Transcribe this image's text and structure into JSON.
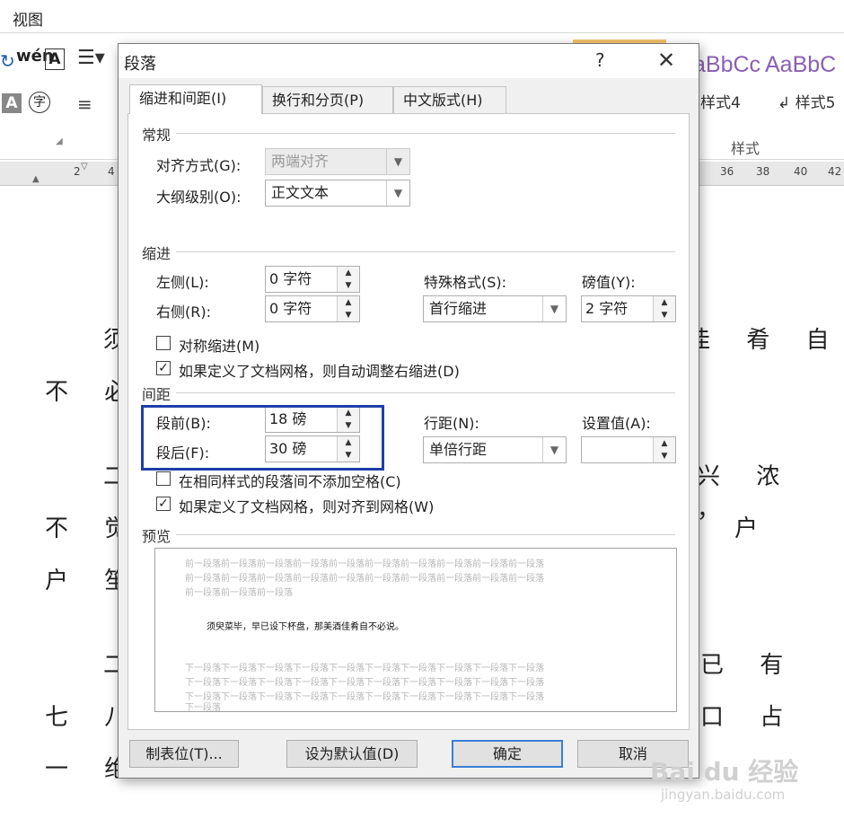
{
  "menu": {
    "view": "视图"
  },
  "ribbon": {
    "style_samples": [
      "aBbCc",
      "AaBbC"
    ],
    "style_labels": [
      "样式4",
      "↲ 样式5"
    ],
    "group_label": "样式"
  },
  "ruler": {
    "left_ticks": [
      "2",
      "4"
    ],
    "right_ticks": [
      "36",
      "38",
      "40",
      "42"
    ]
  },
  "document": {
    "fragments": [
      "须",
      "不 必",
      "二",
      "不 觉",
      "户 笙",
      "二",
      "七 八",
      "一 绝",
      "佳 肴 自",
      "兴 浓 ，",
      "户",
      "已 有",
      "口 占"
    ]
  },
  "dialog": {
    "title": "段落",
    "help": "?",
    "close": "✕",
    "tabs": [
      {
        "label": "缩进和间距(I)",
        "active": true
      },
      {
        "label": "换行和分页(P)",
        "active": false
      },
      {
        "label": "中文版式(H)",
        "active": false
      }
    ],
    "general": {
      "title": "常规",
      "alignment_label": "对齐方式(G):",
      "alignment_value": "两端对齐",
      "outline_label": "大纲级别(O):",
      "outline_value": "正文文本"
    },
    "indent": {
      "title": "缩进",
      "left_label": "左侧(L):",
      "left_value": "0 字符",
      "right_label": "右侧(R):",
      "right_value": "0 字符",
      "special_label": "特殊格式(S):",
      "special_value": "首行缩进",
      "by_label": "磅值(Y):",
      "by_value": "2 字符",
      "mirror_label": "对称缩进(M)",
      "mirror_checked": false,
      "auto_right_label": "如果定义了文档网格，则自动调整右缩进(D)",
      "auto_right_checked": true
    },
    "spacing": {
      "title": "间距",
      "before_label": "段前(B):",
      "before_value": "18 磅",
      "after_label": "段后(F):",
      "after_value": "30 磅",
      "line_label": "行距(N):",
      "line_value": "单倍行距",
      "at_label": "设置值(A):",
      "at_value": "",
      "no_space_label": "在相同样式的段落间不添加空格(C)",
      "no_space_checked": false,
      "snap_label": "如果定义了文档网格，则对齐到网格(W)",
      "snap_checked": true
    },
    "preview": {
      "title": "预览",
      "prev_lines": [
        "前一段落前一段落前一段落前一段落前一段落前一段落前一段落前一段落前一段落前一段落",
        "前一段落前一段落前一段落前一段落前一段落前一段落前一段落前一段落前一段落前一段落",
        "前一段落前一段落前一段落"
      ],
      "sample_text": "须臾菜毕，早已设下杯盘，那美酒佳肴自不必说。",
      "next_lines": [
        "下一段落下一段落下一段落下一段落下一段落下一段落下一段落下一段落下一段落下一段落",
        "下一段落下一段落下一段落下一段落下一段落下一段落下一段落下一段落下一段落下一段落",
        "下一段落下一段落下一段落下一段落下一段落下一段落下一段落下一段落下一段落下一段落",
        "下一段落"
      ]
    },
    "buttons": {
      "tabs": "制表位(T)...",
      "set_default": "设为默认值(D)",
      "ok": "确定",
      "cancel": "取消"
    }
  },
  "watermark": {
    "brand": "Bai du 经验",
    "url": "jingyan.baidu.com"
  }
}
